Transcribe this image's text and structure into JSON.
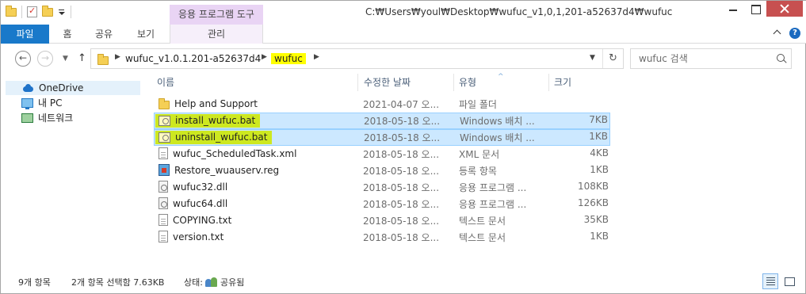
{
  "window": {
    "title_path": "C:₩Users₩youl₩Desktop₩wufuc_v1,0,1,201-a52637d4₩wufuc",
    "contextual_tab_header": "응용 프로그램 도구"
  },
  "ribbon": {
    "tabs": [
      "파일",
      "홈",
      "공유",
      "보기",
      "관리"
    ],
    "file_tab_color": "#1979ca",
    "contextual_color": "#e9d4f4"
  },
  "address": {
    "crumbs": [
      "wufuc_v1.0.1.201-a52637d4",
      "wufuc"
    ],
    "highlight_color": "#ffff00"
  },
  "search": {
    "placeholder": "wufuc 검색"
  },
  "nav": {
    "items": [
      "OneDrive",
      "내 PC",
      "네트워크"
    ]
  },
  "columns": {
    "name": "이름",
    "date": "수정한 날짜",
    "type": "유형",
    "size": "크기"
  },
  "files": [
    {
      "name": "Help and Support",
      "date": "2021-04-07 오...",
      "type": "파일 폴더",
      "size": "",
      "icon": "folder-icon"
    },
    {
      "name": "install_wufuc.bat",
      "date": "2018-05-18 오...",
      "type": "Windows 배치 ...",
      "size": "7KB",
      "icon": "batch-file-icon"
    },
    {
      "name": "uninstall_wufuc.bat",
      "date": "2018-05-18 오...",
      "type": "Windows 배치 ...",
      "size": "1KB",
      "icon": "batch-file-icon"
    },
    {
      "name": "wufuc_ScheduledTask.xml",
      "date": "2018-05-18 오...",
      "type": "XML 문서",
      "size": "4KB",
      "icon": "xml-file-icon"
    },
    {
      "name": "Restore_wuauserv.reg",
      "date": "2018-05-18 오...",
      "type": "등록 항목",
      "size": "1KB",
      "icon": "registry-file-icon"
    },
    {
      "name": "wufuc32.dll",
      "date": "2018-05-18 오...",
      "type": "응용 프로그램 ...",
      "size": "108KB",
      "icon": "dll-file-icon"
    },
    {
      "name": "wufuc64.dll",
      "date": "2018-05-18 오...",
      "type": "응용 프로그램 ...",
      "size": "126KB",
      "icon": "dll-file-icon"
    },
    {
      "name": "COPYING.txt",
      "date": "2018-05-18 오...",
      "type": "텍스트 문서",
      "size": "35KB",
      "icon": "text-file-icon"
    },
    {
      "name": "version.txt",
      "date": "2018-05-18 오...",
      "type": "텍스트 문서",
      "size": "1KB",
      "icon": "text-file-icon"
    }
  ],
  "selection_highlight_color": "#cde820",
  "status": {
    "item_count": "9개 항목",
    "selected": "2개 항목 선택함 7.63KB",
    "state_label": "상태:",
    "state_value": "공유됨"
  }
}
